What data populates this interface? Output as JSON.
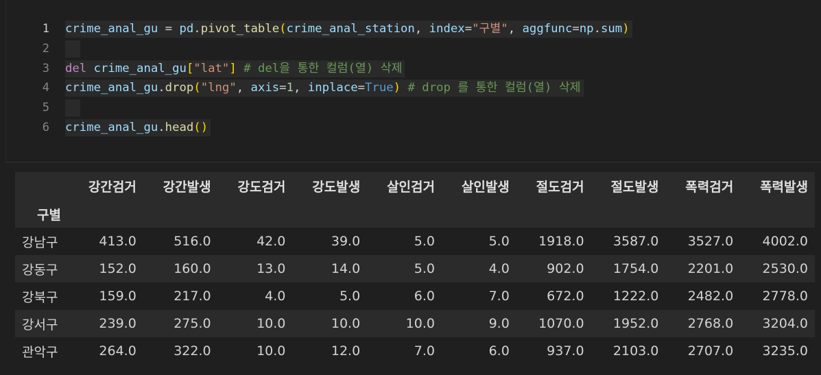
{
  "code_cell": {
    "line_numbers": [
      "1",
      "2",
      "3",
      "4",
      "5",
      "6"
    ],
    "lines": {
      "l1": {
        "var": "crime_anal_gu",
        "eq": " = ",
        "mod": "pd",
        "dot": ".",
        "func": "pivot_table",
        "open": "(",
        "arg1": "crime_anal_station",
        "comma1": ", ",
        "kw1": "index",
        "eq1": "=",
        "str1": "\"구별\"",
        "comma2": ", ",
        "kw2": "aggfunc",
        "eq2": "=",
        "mod2": "np",
        "dot2": ".",
        "attr2": "sum",
        "close": ")"
      },
      "l3": {
        "kw": "del",
        "var": " crime_anal_gu",
        "open": "[",
        "str": "\"lat\"",
        "close": "]",
        "comment": " # del을 통한 컬럼(열) 삭제"
      },
      "l4": {
        "var": "crime_anal_gu",
        "dot": ".",
        "func": "drop",
        "open": "(",
        "str": "\"lng\"",
        "comma1": ", ",
        "kw1": "axis",
        "eq1": "=",
        "num": "1",
        "comma2": ", ",
        "kw2": "inplace",
        "eq2": "=",
        "bool": "True",
        "close": ")",
        "comment": " # drop 를 통한 컬럼(열) 삭제"
      },
      "l6": {
        "var": "crime_anal_gu",
        "dot": ".",
        "func": "head",
        "open": "(",
        "close": ")"
      }
    }
  },
  "dataframe": {
    "index_name": "구별",
    "columns": [
      "강간검거",
      "강간발생",
      "강도검거",
      "강도발생",
      "살인검거",
      "살인발생",
      "절도검거",
      "절도발생",
      "폭력검거",
      "폭력발생"
    ],
    "rows": [
      {
        "label": "강남구",
        "values": [
          "413.0",
          "516.0",
          "42.0",
          "39.0",
          "5.0",
          "5.0",
          "1918.0",
          "3587.0",
          "3527.0",
          "4002.0"
        ]
      },
      {
        "label": "강동구",
        "values": [
          "152.0",
          "160.0",
          "13.0",
          "14.0",
          "5.0",
          "4.0",
          "902.0",
          "1754.0",
          "2201.0",
          "2530.0"
        ]
      },
      {
        "label": "강북구",
        "values": [
          "159.0",
          "217.0",
          "4.0",
          "5.0",
          "6.0",
          "7.0",
          "672.0",
          "1222.0",
          "2482.0",
          "2778.0"
        ]
      },
      {
        "label": "강서구",
        "values": [
          "239.0",
          "275.0",
          "10.0",
          "10.0",
          "10.0",
          "9.0",
          "1070.0",
          "1952.0",
          "2768.0",
          "3204.0"
        ]
      },
      {
        "label": "관악구",
        "values": [
          "264.0",
          "322.0",
          "10.0",
          "12.0",
          "7.0",
          "6.0",
          "937.0",
          "2103.0",
          "2707.0",
          "3235.0"
        ]
      }
    ]
  }
}
